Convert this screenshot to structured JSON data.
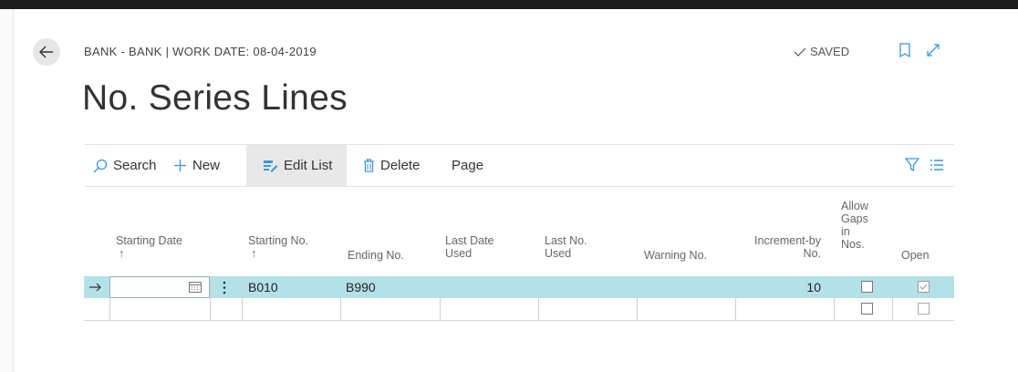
{
  "header": {
    "breadcrumb": "BANK - BANK | WORK DATE: 08-04-2019",
    "saved_label": "SAVED",
    "title": "No. Series Lines"
  },
  "actions": {
    "search": "Search",
    "new": "New",
    "edit_list": "Edit List",
    "delete": "Delete",
    "page": "Page"
  },
  "columns": {
    "starting_date": "Starting Date",
    "starting_no": "Starting No.",
    "ending_no": "Ending No.",
    "last_date_used_1": "Last Date",
    "last_date_used_2": "Used",
    "last_no_used_1": "Last No.",
    "last_no_used_2": "Used",
    "warning_no": "Warning No.",
    "increment_1": "Increment-by",
    "increment_2": "No.",
    "allow_gaps_1": "Allow",
    "allow_gaps_2": "Gaps",
    "allow_gaps_3": "in",
    "allow_gaps_4": "Nos.",
    "open": "Open",
    "sort_arrow": "↑"
  },
  "rows": [
    {
      "starting_no": "B010",
      "ending_no": "B990",
      "increment_by": "10",
      "allow_gaps": false,
      "open": true
    },
    {
      "starting_no": "",
      "ending_no": "",
      "increment_by": "",
      "allow_gaps": false,
      "open": false
    }
  ],
  "colors": {
    "selected_row": "#b4e1e8",
    "accent": "#3a96dd"
  }
}
